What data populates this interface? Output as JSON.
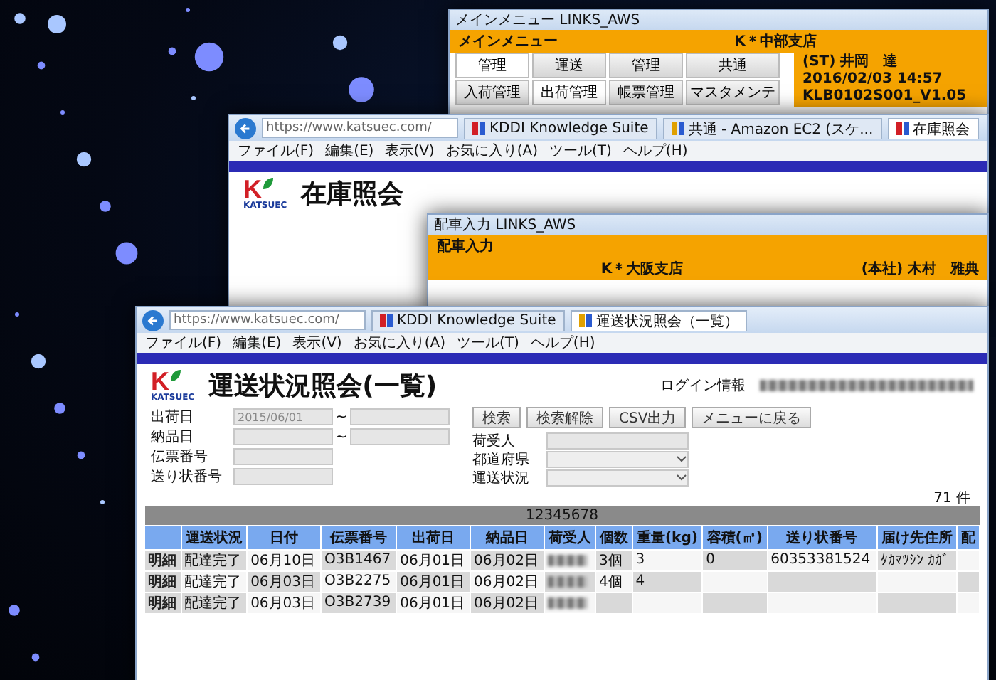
{
  "main_menu_window": {
    "title": "メインメニュー LINKS_AWS",
    "header": "メインメニュー",
    "branch": "K＊中部支店",
    "menu_buttons": [
      {
        "label": "管理",
        "selected": true
      },
      {
        "label": "運送",
        "selected": false
      },
      {
        "label": "管理",
        "selected": false
      },
      {
        "label": "共通",
        "selected": false
      },
      {
        "label": "入荷管理",
        "selected": false
      },
      {
        "label": "出荷管理",
        "selected": true
      },
      {
        "label": "帳票管理",
        "selected": false
      },
      {
        "label": "マスタメンテ",
        "selected": false
      }
    ],
    "user": "(ST) 井岡　達",
    "datetime": "2016/02/03 14:57",
    "version": "KLB0102S001_V1.05"
  },
  "stock_window": {
    "url": "https://www.katsuec.com/",
    "menu": [
      "ファイル(F)",
      "編集(E)",
      "表示(V)",
      "お気に入り(A)",
      "ツール(T)",
      "ヘルプ(H)"
    ],
    "tabs": [
      {
        "label": "KDDI Knowledge Suite",
        "selected": false
      },
      {
        "label": "共通 - Amazon EC2 (スケ...",
        "selected": false
      },
      {
        "label": "在庫照会",
        "selected": true
      }
    ],
    "logo": {
      "letter": "K",
      "name": "KATSUEC"
    },
    "title": "在庫照会"
  },
  "dispatch_window": {
    "title": "配車入力 LINKS_AWS",
    "header": "配車入力",
    "branch": "K＊大阪支店",
    "user": "(本社) 木村　雅典"
  },
  "shipment_window": {
    "url": "https://www.katsuec.com/",
    "menu": [
      "ファイル(F)",
      "編集(E)",
      "表示(V)",
      "お気に入り(A)",
      "ツール(T)",
      "ヘルプ(H)"
    ],
    "tabs": [
      {
        "label": "KDDI Knowledge Suite",
        "selected": false
      },
      {
        "label": "運送状況照会（一覧）",
        "selected": true
      }
    ],
    "logo": {
      "letter": "K",
      "name": "KATSUEC"
    },
    "title": "運送状況照会(一覧)",
    "login_label": "ログイン情報",
    "filters": [
      {
        "label": "出荷日",
        "from": "2015/06/01",
        "separator": "~"
      },
      {
        "label": "納品日",
        "separator": "~"
      },
      {
        "label": "伝票番号"
      },
      {
        "label": "送り状番号"
      }
    ],
    "buttons": [
      "検索",
      "検索解除",
      "CSV出力",
      "メニューに戻る"
    ],
    "right_filters": [
      {
        "label": "荷受人",
        "kind": "text"
      },
      {
        "label": "都道府県",
        "kind": "select"
      },
      {
        "label": "運送状況",
        "kind": "select"
      }
    ],
    "code": "12345678",
    "count": "71 件",
    "columns": [
      "運送状況",
      "日付",
      "伝票番号",
      "出荷日",
      "納品日",
      "荷受人",
      "個数",
      "重量(kg)",
      "容積(㎥)",
      "送り状番号",
      "届け先住所",
      "配"
    ],
    "rows": [
      {
        "detail": "明細",
        "status": "配達完了",
        "date": "06月10日",
        "slip": "O3B1467",
        "ship_date": "06月01日",
        "delivery_date": "06月02日",
        "qty": "3個",
        "weight": "3",
        "volume": "0",
        "invoice": "60353381524",
        "address": "ﾀｶﾏﾂｼﾝ ｶｶﾞ"
      },
      {
        "detail": "明細",
        "status": "配達完了",
        "date": "06月03日",
        "slip": "O3B2275",
        "ship_date": "06月01日",
        "delivery_date": "06月02日",
        "qty": "4個",
        "weight": "4"
      },
      {
        "detail": "明細",
        "status": "配達完了",
        "date": "06月03日",
        "slip": "O3B2739",
        "ship_date": "06月01日",
        "delivery_date": "06月02日"
      }
    ]
  }
}
